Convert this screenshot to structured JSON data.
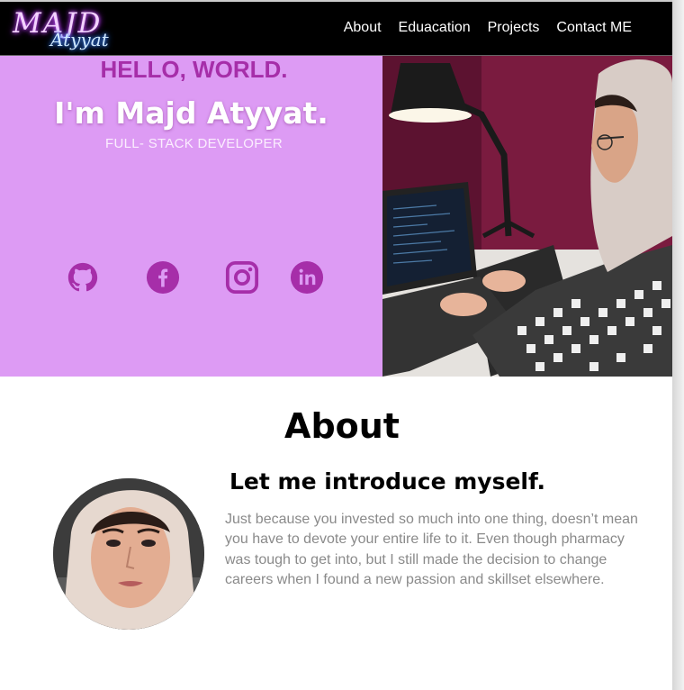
{
  "brand": {
    "logo_main": "MAJD",
    "logo_sub": "Atyyat"
  },
  "nav": {
    "items": [
      "About",
      "Eduacation",
      "Projects",
      "Contact ME"
    ]
  },
  "hero": {
    "greeting": "HELLO, WORLD.",
    "name": "I'm Majd Atyyat.",
    "role": "FULL- STACK DEVELOPER",
    "background_color": "#dd9bf4",
    "accent_color": "#a62ea9",
    "social_icons": [
      "github-icon",
      "facebook-icon",
      "instagram-icon",
      "linkedin-icon"
    ]
  },
  "about": {
    "title": "About",
    "subtitle": "Let me introduce myself.",
    "body": "Just because you invested so much into one thing, doesn’t mean you have to devote your entire life to it. Even though pharmacy was tough to get into, but I still made the decision to change careers when I found a new passion and skillset elsewhere."
  }
}
